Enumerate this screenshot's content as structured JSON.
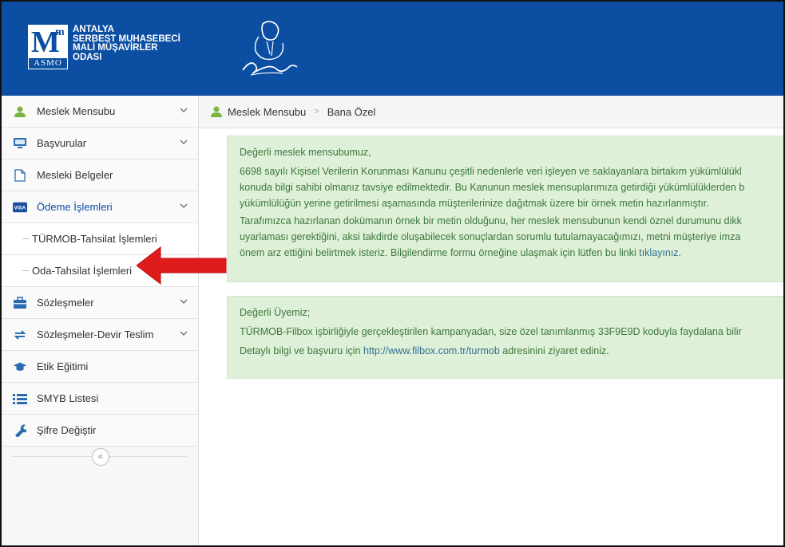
{
  "org": {
    "logo_letter": "M",
    "logo_sup": "m",
    "logo_abbr": "ASMO",
    "name_lines": [
      "ANTALYA",
      "SERBEST MUHASEBECİ",
      "MALİ MÜŞAVİRLER",
      "ODASI"
    ]
  },
  "colors": {
    "header_blue": "#0b4ea2",
    "alert_bg": "#dff0d8",
    "alert_text": "#3c763d",
    "link": "#31708f",
    "arrow_red": "#e01b1b"
  },
  "sidebar": {
    "items": [
      {
        "label": "Meslek Mensubu",
        "icon": "user-icon"
      },
      {
        "label": "Başvurular",
        "icon": "monitor-icon"
      },
      {
        "label": "Mesleki Belgeler",
        "icon": "document-icon"
      },
      {
        "label": "Ödeme İşlemleri",
        "icon": "visa-card-icon"
      },
      {
        "label": "Sözleşmeler",
        "icon": "briefcase-icon"
      },
      {
        "label": "Sözleşmeler-Devir Teslim",
        "icon": "transfer-icon"
      },
      {
        "label": "Etik Eğitimi",
        "icon": "graduation-cap-icon"
      },
      {
        "label": "SMYB Listesi",
        "icon": "list-icon"
      },
      {
        "label": "Şifre Değiştir",
        "icon": "wrench-icon"
      }
    ],
    "sub_items": [
      "TÜRMOB-Tahsilat İşlemleri",
      "Oda-Tahsilat İşlemleri"
    ],
    "collapse_symbol": "«"
  },
  "breadcrumb": {
    "items": [
      "Meslek Mensubu",
      "Bana Özel"
    ],
    "separator": ">"
  },
  "alerts": {
    "first": {
      "greeting": "Değerli meslek mensubumuz,",
      "line1": "6698 sayılı Kişisel Verilerin Korunması Kanunu çeşitli nedenlerle veri işleyen ve saklayanlara birtakım yükümlülükl",
      "line2": "konuda bilgi sahibi olmanız tavsiye edilmektedir. Bu Kanunun meslek mensuplarımıza getirdiği yükümlülüklerden b",
      "line3": "yükümlülüğün yerine getirilmesi aşamasında müşterilerinize dağıtmak üzere bir örnek metin hazırlanmıştır.",
      "line4": "Tarafımızca hazırlanan dokümanın örnek bir metin olduğunu, her meslek mensubunun kendi öznel durumunu dikk",
      "line5": "uyarlaması gerektiğini, aksi takdirde oluşabilecek sonuçlardan sorumlu tutulamayacağımızı, metni müşteriye imza",
      "line6_text": "önem arz ettiğini belirtmek isteriz. Bilgilendirme formu örneğine ulaşmak için lütfen bu linki ",
      "line6_link": "tıklayınız."
    },
    "second": {
      "greeting": "Değerli Üyemiz;",
      "line1": "TÜRMOB-Filbox işbirliğiyle gerçekleştirilen kampanyadan, size özel tanımlanmış 33F9E9D koduyla faydalana bilir",
      "line2_pre": "Detaylı bilgi ve başvuru için ",
      "line2_link": "http://www.filbox.com.tr/turmob",
      "line2_post": " adresinini ziyaret ediniz."
    }
  }
}
